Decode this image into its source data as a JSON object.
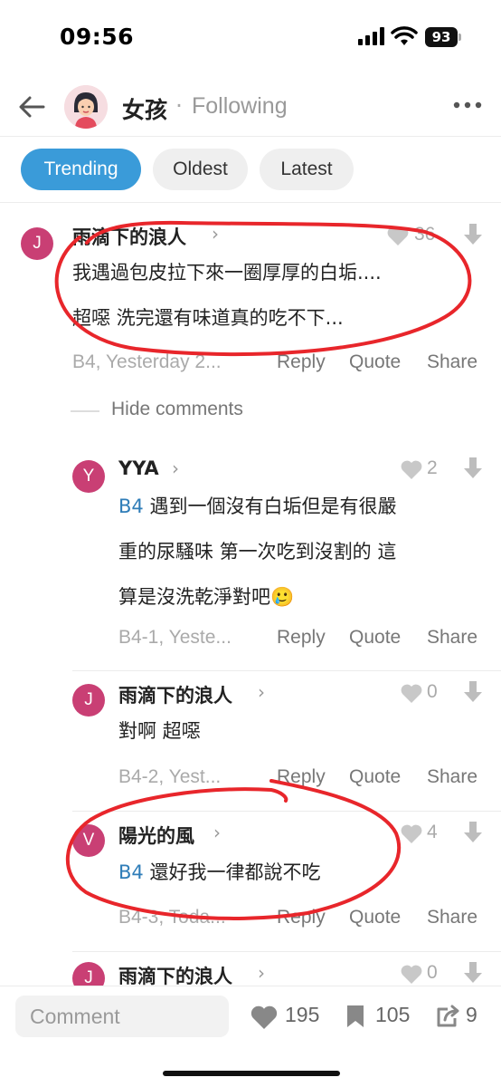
{
  "status_bar": {
    "time": "09:56",
    "battery": "93"
  },
  "header": {
    "title": "女孩",
    "separator": "·",
    "following": "Following"
  },
  "tabs": [
    {
      "label": "Trending",
      "active": true
    },
    {
      "label": "Oldest",
      "active": false
    },
    {
      "label": "Latest",
      "active": false
    }
  ],
  "actions": {
    "reply": "Reply",
    "quote": "Quote",
    "share": "Share"
  },
  "hide_comments": "Hide comments",
  "comments": [
    {
      "avatar_letter": "J",
      "username": "雨滴下的浪人",
      "likes": "36",
      "lines": [
        "我遇過包皮拉下來一圈厚厚的白垢....",
        "超噁 洗完還有味道真的吃不下..."
      ],
      "meta": "B4, Yesterday 2..."
    },
    {
      "avatar_letter": "Y",
      "username": "YYA",
      "likes": "2",
      "ref": "B4",
      "lines": [
        "遇到一個沒有白垢但是有很嚴",
        "重的尿騷味 第一次吃到沒割的 這",
        "算是沒洗乾淨對吧🥲"
      ],
      "meta": "B4-1, Yeste..."
    },
    {
      "avatar_letter": "J",
      "username": "雨滴下的浪人",
      "likes": "0",
      "lines": [
        "對啊 超噁"
      ],
      "meta": "B4-2, Yest..."
    },
    {
      "avatar_letter": "V",
      "username": "陽光的風",
      "likes": "4",
      "ref": "B4",
      "lines": [
        "還好我一律都說不吃"
      ],
      "meta": "B4-3, Toda..."
    },
    {
      "avatar_letter": "J",
      "username": "雨滴下的浪人",
      "likes": "0"
    }
  ],
  "bottom_bar": {
    "comment_placeholder": "Comment",
    "likes": "195",
    "bookmarks": "105",
    "shares": "9"
  },
  "colors": {
    "accent": "#3a9bd9",
    "avatar": "#c93f74",
    "reference": "#2f7db8",
    "annotation": "#e8262b"
  }
}
